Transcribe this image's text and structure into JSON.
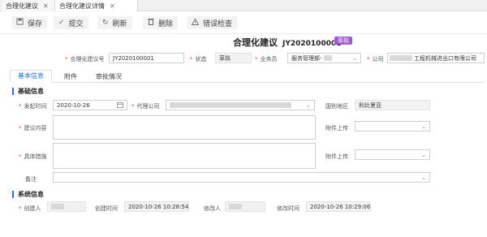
{
  "tabs": [
    {
      "label": "合理化建议"
    },
    {
      "label": "合理化建议详情"
    }
  ],
  "toolbar": {
    "save": "保存",
    "submit": "提交",
    "refresh": "刷新",
    "delete": "删除",
    "check": "错误检查"
  },
  "header": {
    "title": "合理化建议",
    "code": "JY2020100001",
    "status_badge": "草拟"
  },
  "top_fields": {
    "suggestion_no_label": "合理化建议号",
    "suggestion_no": "JY2020100001",
    "status_label": "状态",
    "status": "草拟",
    "clerk_label": "业务员",
    "clerk": "服务管理部-",
    "company_label": "公司",
    "company": "工程机械进出口有限公司"
  },
  "content_tabs": [
    {
      "label": "基本信息"
    },
    {
      "label": "附件"
    },
    {
      "label": "审批情况"
    }
  ],
  "basic": {
    "section_title": "基础信息",
    "start_time_label": "发起时间",
    "start_time": "2020-10-26",
    "agent_company_label": "代理公司",
    "region_label": "国别地区",
    "region": "利比里亚",
    "content_label": "建议内容",
    "attach_label_1": "附件上传",
    "measures_label": "具体措施",
    "attach_label_2": "附件上传",
    "remark_label": "备注"
  },
  "system": {
    "section_title": "系统信息",
    "creator_label": "创建人",
    "created_time_label": "创建时间",
    "created_time": "2020-10-26 10:28:54",
    "modifier_label": "修改人",
    "modified_time_label": "修改时间",
    "modified_time": "2020-10-26 10:29:06"
  }
}
